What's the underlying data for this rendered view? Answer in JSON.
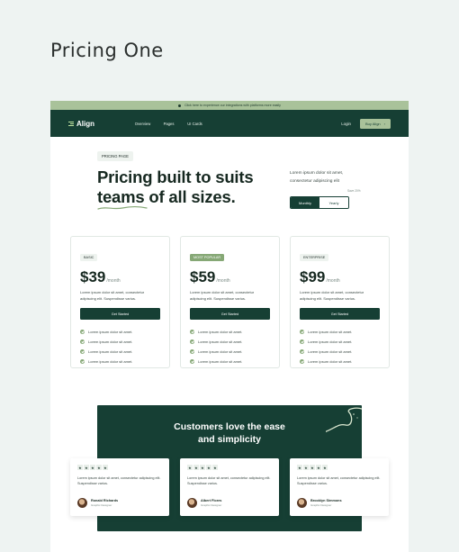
{
  "page": {
    "title": "Pricing One"
  },
  "announcement": {
    "text": "Click here to experience our integrations with platforms more easily"
  },
  "nav": {
    "brand": "Align",
    "links": [
      "Overview",
      "Pages",
      "UI Cards"
    ],
    "login": "Login",
    "buy": "Buy Align",
    "buy_arrow": "›"
  },
  "hero": {
    "pill": "PRICING PAGE",
    "headline_line1": "Pricing built to suits",
    "headline_line2": "teams of all sizes.",
    "description": "Lorem ipsum dolor sit amet, consectetur adipiscing elit",
    "toggle": {
      "monthly": "Monthly",
      "yearly": "Yearly",
      "note": "Save 20%"
    }
  },
  "plans": [
    {
      "tag": "BASIC",
      "price": "$39",
      "period": "/month",
      "description": "Lorem ipsum dolor sit amet, consectetur adipiscing elit. Suspendisse varius.",
      "cta": "Get Started",
      "features": [
        "Lorem ipsum dolor sit amet.",
        "Lorem ipsum dolor sit amet.",
        "Lorem ipsum dolor sit amet.",
        "Lorem ipsum dolor sit amet."
      ]
    },
    {
      "tag": "MOST POPULAR",
      "price": "$59",
      "period": "/month",
      "description": "Lorem ipsum dolor sit amet, consectetur adipiscing elit. Suspendisse varius.",
      "cta": "Get Started",
      "features": [
        "Lorem ipsum dolor sit amet.",
        "Lorem ipsum dolor sit amet.",
        "Lorem ipsum dolor sit amet.",
        "Lorem ipsum dolor sit amet."
      ]
    },
    {
      "tag": "ENTERPRISE",
      "price": "$99",
      "period": "/month",
      "description": "Lorem ipsum dolor sit amet, consectetur adipiscing elit. Suspendisse varius.",
      "cta": "Get Started",
      "features": [
        "Lorem ipsum dolor sit amet.",
        "Lorem ipsum dolor sit amet.",
        "Lorem ipsum dolor sit amet.",
        "Lorem ipsum dolor sit amet."
      ]
    }
  ],
  "testimonials": {
    "title_line1": "Customers love the ease",
    "title_line2": "and simplicity",
    "items": [
      {
        "rating": 5,
        "text": "Lorem ipsum dolor sit amet, consectetur adipiscing elit. Suspendisse varius.",
        "name": "Ronald Richards",
        "role": "Graphic Designer"
      },
      {
        "rating": 5,
        "text": "Lorem ipsum dolor sit amet, consectetur adipiscing elit. Suspendisse varius.",
        "name": "Albert Flores",
        "role": "Graphic Designer"
      },
      {
        "rating": 5,
        "text": "Lorem ipsum dolor sit amet, consectetur adipiscing elit. Suspendisse varius.",
        "name": "Brooklyn Simmons",
        "role": "Graphic Designer"
      }
    ]
  },
  "colors": {
    "primary": "#163f34",
    "accent": "#a9c29a",
    "popular": "#86a876",
    "background": "#eef3f2"
  },
  "icons": {
    "star": "star-icon",
    "check": "check-icon",
    "announce": "info-dot-icon"
  }
}
